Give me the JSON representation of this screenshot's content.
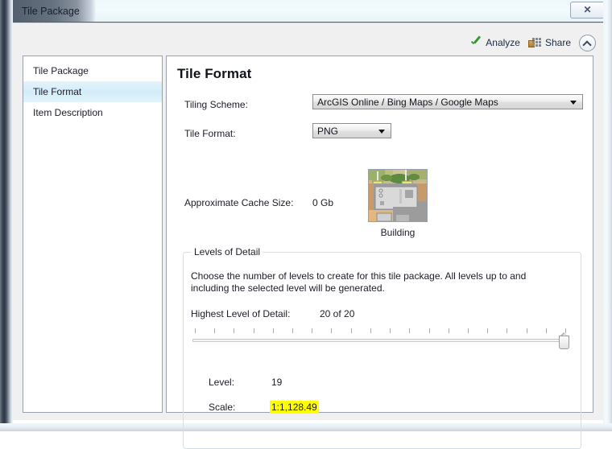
{
  "window": {
    "title": "Tile Package",
    "close_label": "✕"
  },
  "commandbar": {
    "analyze_label": "Analyze",
    "share_label": "Share",
    "analyze_icon": "green-check-icon",
    "share_icon": "share-package-icon",
    "collapse_icon": "chevron-up-icon"
  },
  "sidebar": {
    "items": [
      {
        "label": "Tile Package",
        "selected": false
      },
      {
        "label": "Tile Format",
        "selected": true
      },
      {
        "label": "Item Description",
        "selected": false
      }
    ]
  },
  "main": {
    "page_title": "Tile Format",
    "fields": {
      "tiling_scheme_label": "Tiling Scheme:",
      "tiling_scheme_value": "ArcGIS Online / Bing Maps / Google Maps",
      "tile_format_label": "Tile Format:",
      "tile_format_value": "PNG",
      "cache_size_label": "Approximate Cache Size:",
      "cache_size_value": "0 Gb"
    },
    "levels_of_detail": {
      "group_title": "Levels of Detail",
      "description": "Choose the number of levels to create for this tile package.   All levels up to and including the selected level will be generated.",
      "highest_lod_label": "Highest Level of Detail:",
      "highest_lod_value": "20 of 20",
      "slider": {
        "min": 1,
        "max": 20,
        "value": 20,
        "tick_count": 20
      },
      "level_label": "Level:",
      "level_value": "19",
      "scale_label": "Scale:",
      "scale_value": "1:1,128.49",
      "scale_highlight_color": "#ffff00",
      "preview_caption": "Building"
    }
  },
  "colors": {
    "selection_blue": "#d3ecf8",
    "accent_green": "#2f9e2f",
    "highlight_yellow": "#ffff00",
    "panel_gray": "#f0f0f0"
  }
}
